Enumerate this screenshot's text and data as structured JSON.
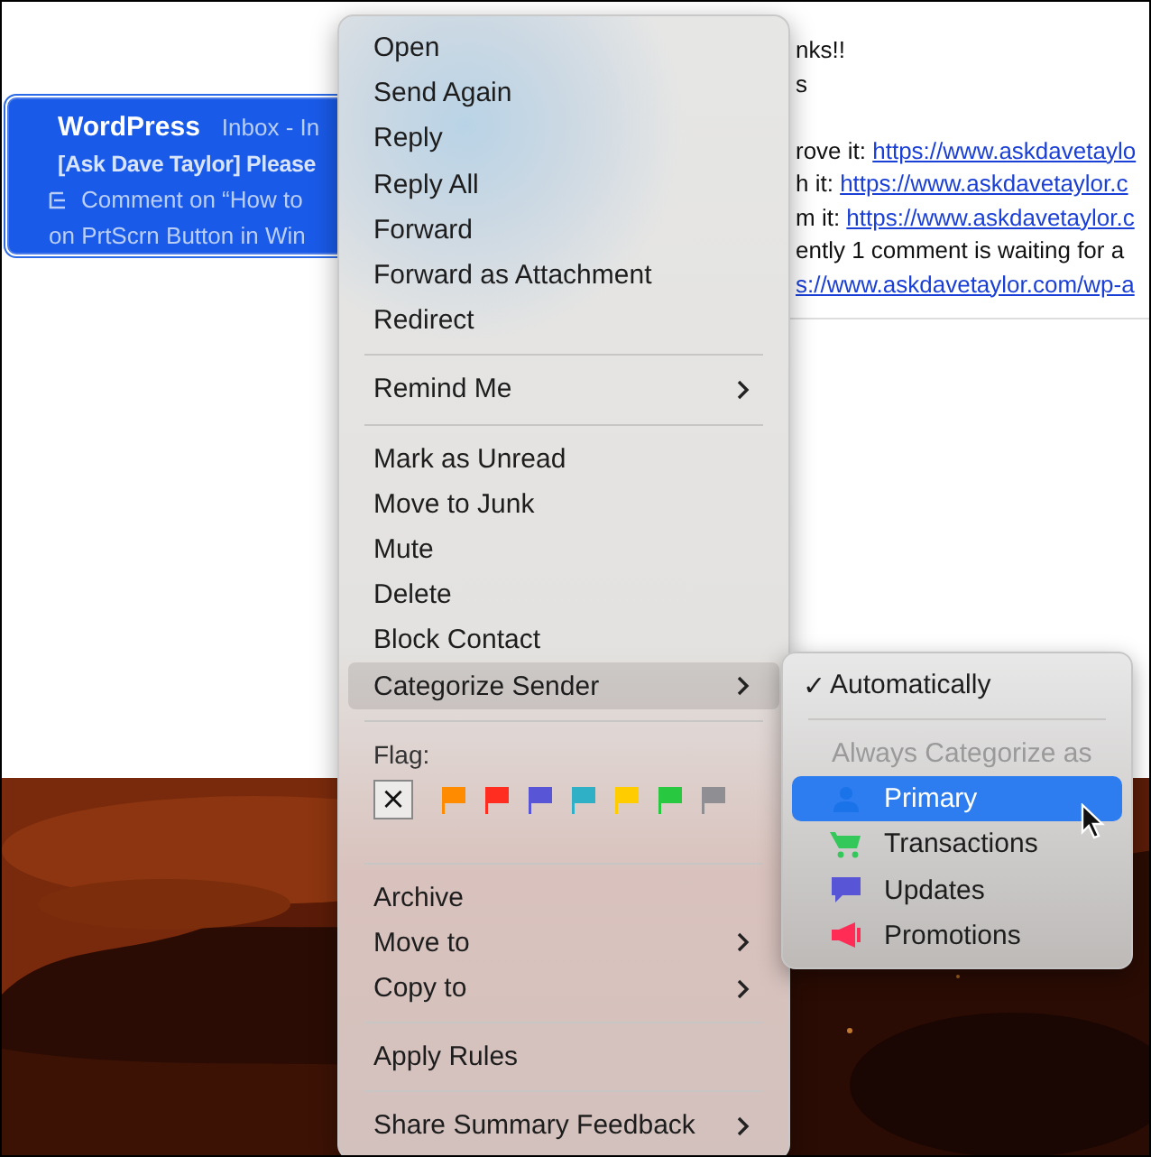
{
  "message_list": {
    "items": [
      {
        "sender": "WordPress",
        "mailbox": "Inbox - In",
        "subject": "[Ask Dave Taylor] Please",
        "preview_lines": [
          "Comment on “How to",
          "on PrtScrn Button in Win"
        ],
        "selected": true
      }
    ]
  },
  "message_body": {
    "lines": [
      {
        "text": "nks!!"
      },
      {
        "text": "s"
      },
      {
        "text": "rove it: ",
        "link": "https://www.askdavetaylo",
        "space_before": true
      },
      {
        "text": "h it: ",
        "link": "https://www.askdavetaylor.c"
      },
      {
        "text": "m it: ",
        "link": "https://www.askdavetaylor.c"
      },
      {
        "text": "ently 1 comment is waiting for a"
      },
      {
        "link": "s://www.askdavetaylor.com/wp-a"
      }
    ]
  },
  "context_menu": {
    "sections": [
      {
        "kind": "items",
        "items": [
          {
            "label": "Open",
            "submenu": false,
            "selected": false
          },
          {
            "label": "Send Again",
            "submenu": false,
            "selected": false
          },
          {
            "label": "Reply",
            "submenu": false,
            "selected": false
          },
          {
            "label": "Reply All",
            "submenu": false,
            "selected": false
          },
          {
            "label": "Forward",
            "submenu": false,
            "selected": false
          },
          {
            "label": "Forward as Attachment",
            "submenu": false,
            "selected": false
          },
          {
            "label": "Redirect",
            "submenu": false,
            "selected": false
          }
        ]
      },
      {
        "kind": "items",
        "items": [
          {
            "label": "Remind Me",
            "submenu": true,
            "selected": false
          }
        ]
      },
      {
        "kind": "items",
        "items": [
          {
            "label": "Mark as Unread",
            "submenu": false,
            "selected": false
          },
          {
            "label": "Move to Junk",
            "submenu": false,
            "selected": false
          },
          {
            "label": "Mute",
            "submenu": false,
            "selected": false
          },
          {
            "label": "Delete",
            "submenu": false,
            "selected": false
          },
          {
            "label": "Block Contact",
            "submenu": false,
            "selected": false
          },
          {
            "label": "Categorize Sender",
            "submenu": true,
            "selected": true
          }
        ]
      },
      {
        "kind": "flags",
        "label": "Flag:",
        "clear": "×",
        "flags": [
          {
            "color": "#ff8c00"
          },
          {
            "color": "#ff2d20"
          },
          {
            "color": "#5856d6"
          },
          {
            "color": "#30b0c7"
          },
          {
            "color": "#ffcc00"
          },
          {
            "color": "#28c840"
          },
          {
            "color": "#8e8e93"
          }
        ]
      },
      {
        "kind": "items",
        "items": [
          {
            "label": "Archive",
            "submenu": false,
            "selected": false
          },
          {
            "label": "Move to",
            "submenu": true,
            "selected": false
          },
          {
            "label": "Copy to",
            "submenu": true,
            "selected": false
          }
        ]
      },
      {
        "kind": "items",
        "items": [
          {
            "label": "Apply Rules",
            "submenu": false,
            "selected": false
          }
        ]
      },
      {
        "kind": "items",
        "items": [
          {
            "label": "Share Summary Feedback",
            "submenu": true,
            "selected": false
          }
        ]
      }
    ]
  },
  "submenu": {
    "items": [
      {
        "kind": "check",
        "mark": "✓",
        "label": "Automatically",
        "checked": true
      },
      {
        "kind": "separator"
      },
      {
        "kind": "header",
        "label": "Always Categorize as"
      },
      {
        "kind": "person",
        "label": "Primary",
        "color": "#1a73e8",
        "selected": true
      },
      {
        "kind": "cart",
        "label": "Transactions",
        "color": "#34c759",
        "selected": false
      },
      {
        "kind": "chat",
        "label": "Updates",
        "color": "#5856d6",
        "selected": false
      },
      {
        "kind": "megaphone",
        "label": "Promotions",
        "color": "#ff2d55",
        "selected": false
      }
    ]
  }
}
